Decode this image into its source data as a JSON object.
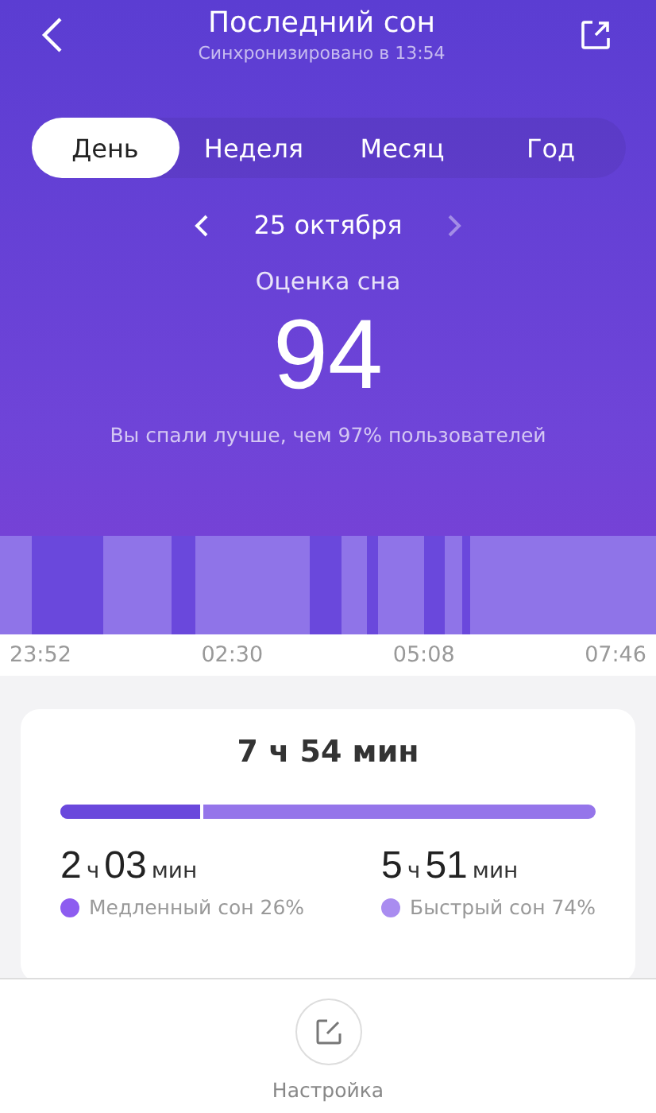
{
  "header": {
    "title": "Последний сон",
    "subtitle": "Синхронизировано в 13:54"
  },
  "tabs": [
    {
      "label": "День",
      "selected": true
    },
    {
      "label": "Неделя",
      "selected": false
    },
    {
      "label": "Месяц",
      "selected": false
    },
    {
      "label": "Год",
      "selected": false
    }
  ],
  "date": "25 октября",
  "score": {
    "label": "Оценка сна",
    "value": "94",
    "comparison": "Вы спали лучше, чем 97% пользователей"
  },
  "time_axis": [
    "23:52",
    "02:30",
    "05:08",
    "07:46"
  ],
  "summary": {
    "total_hours": "7",
    "total_hours_unit": "ч",
    "total_minutes": "54",
    "total_minutes_unit": "мин",
    "level": 0.26,
    "stages": [
      {
        "hours": "2",
        "hours_unit": "ч",
        "minutes": "03",
        "minutes_unit": "мин",
        "label": "Медленный сон 26%",
        "color": "#8d5cf0"
      },
      {
        "hours": "5",
        "hours_unit": "ч",
        "minutes": "51",
        "minutes_unit": "мин",
        "label": "Быстрый сон 74%",
        "color": "#a98cf0"
      }
    ]
  },
  "bottom": {
    "label": "Настройка"
  }
}
